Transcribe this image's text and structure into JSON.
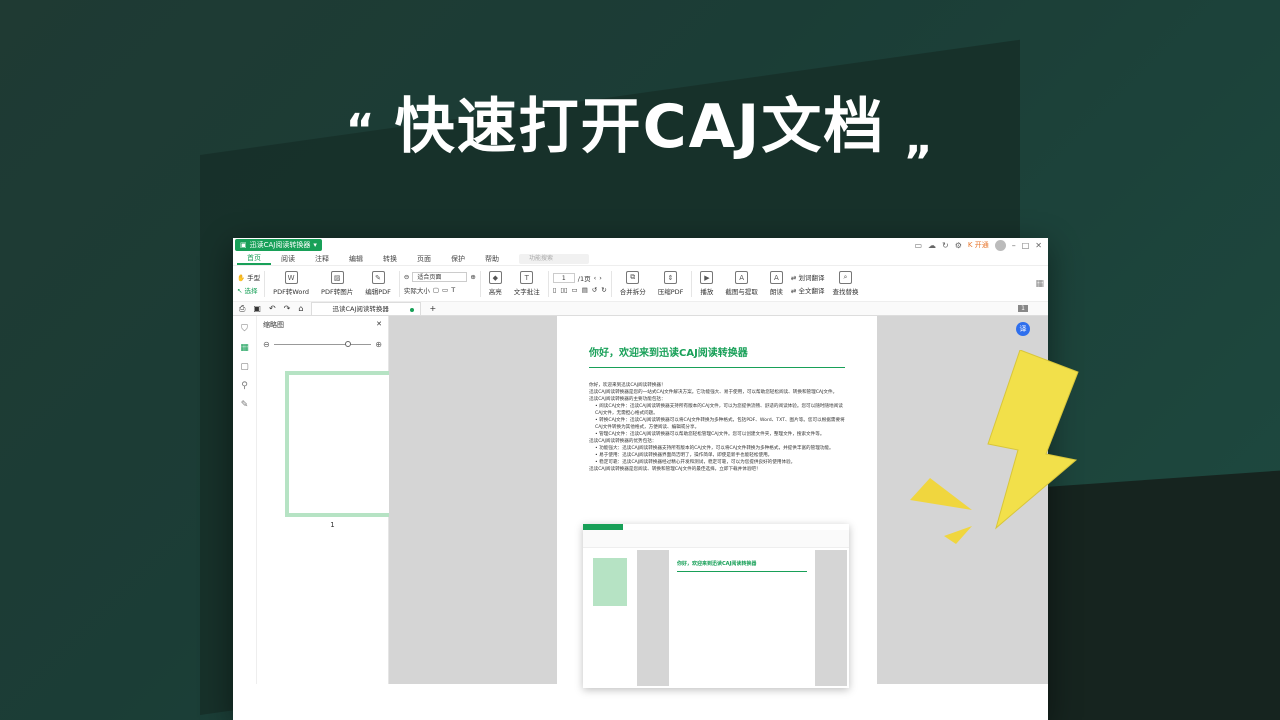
{
  "headline": {
    "open_quote": "“",
    "title": "快速打开CAJ文档",
    "close_quote": "”"
  },
  "app": {
    "name": "迅读CAJ阅读转换器",
    "vip_label": "开通",
    "menu": [
      "首页",
      "阅读",
      "注释",
      "编辑",
      "转换",
      "页面",
      "保护",
      "帮助"
    ],
    "search_placeholder": "功能搜索",
    "toolbar": {
      "hand": "手型",
      "select": "选择",
      "pdf_to_word": "PDF转Word",
      "pdf_to_image": "PDF转图片",
      "edit_pdf": "编辑PDF",
      "zoom_value": "适合页面",
      "actual_size": "实际大小",
      "highlight": "高亮",
      "text_note": "文字批注",
      "page_current": "1",
      "page_total": "/1页",
      "merge_split": "合并拆分",
      "compress": "压缩PDF",
      "play": "播放",
      "screenshot": "截图与提取",
      "read_aloud": "朗读",
      "word_translate": "划词翻译",
      "full_translate": "全文翻译",
      "find_replace": "查找替换"
    },
    "tab_label": "迅读CAJ阅读转换器",
    "page_badge": "1",
    "thumb_title": "缩略图",
    "thumb_page": "1"
  },
  "document": {
    "heading": "你好，欢迎来到迅读CAJ阅读转换器",
    "paragraphs": [
      "你好，欢迎来到迅读CAJ阅读转换器！",
      "迅读CAJ阅读转换器是您的一站式CAJ文件解决方案。它功能强大、易于使用，可以帮助您轻松阅读、转换和管理CAJ文件。",
      "迅读CAJ阅读转换器的主要功能包括：",
      "• 阅读CAJ文件：迅读CAJ阅读转换器支持所有版本的CAJ文件，可以为您提供流畅、舒适的阅读体验。您可以随时随地阅读CAJ文件，无需担心格式问题。",
      "• 转换CAJ文件：迅读CAJ阅读转换器可以将CAJ文件转换为多种格式，包括PDF、Word、TXT、图片等。您可以根据需要将CAJ文件转换为其他格式，方便阅读、编辑或分享。",
      "• 管理CAJ文件：迅读CAJ阅读转换器可以帮助您轻松管理CAJ文件。您可以创建文件夹，整理文件，搜索文件等。",
      "迅读CAJ阅读转换器的优势包括：",
      "• 功能强大：迅读CAJ阅读转换器支持所有版本的CAJ文件，可以将CAJ文件转换为多种格式，并提供丰富的管理功能。",
      "• 易于使用：迅读CAJ阅读转换器界面简洁明了，操作简单，即使是新手也能轻松使用。",
      "• 稳定可靠：迅读CAJ阅读转换器经过精心开发和测试，稳定可靠，可以为您提供良好的使用体验。",
      "迅读CAJ阅读转换器是您阅读、转换和管理CAJ文件的最佳选择，立即下载并体验吧！"
    ]
  },
  "colors": {
    "accent": "#18a058",
    "bolt": "#f2e04a"
  }
}
